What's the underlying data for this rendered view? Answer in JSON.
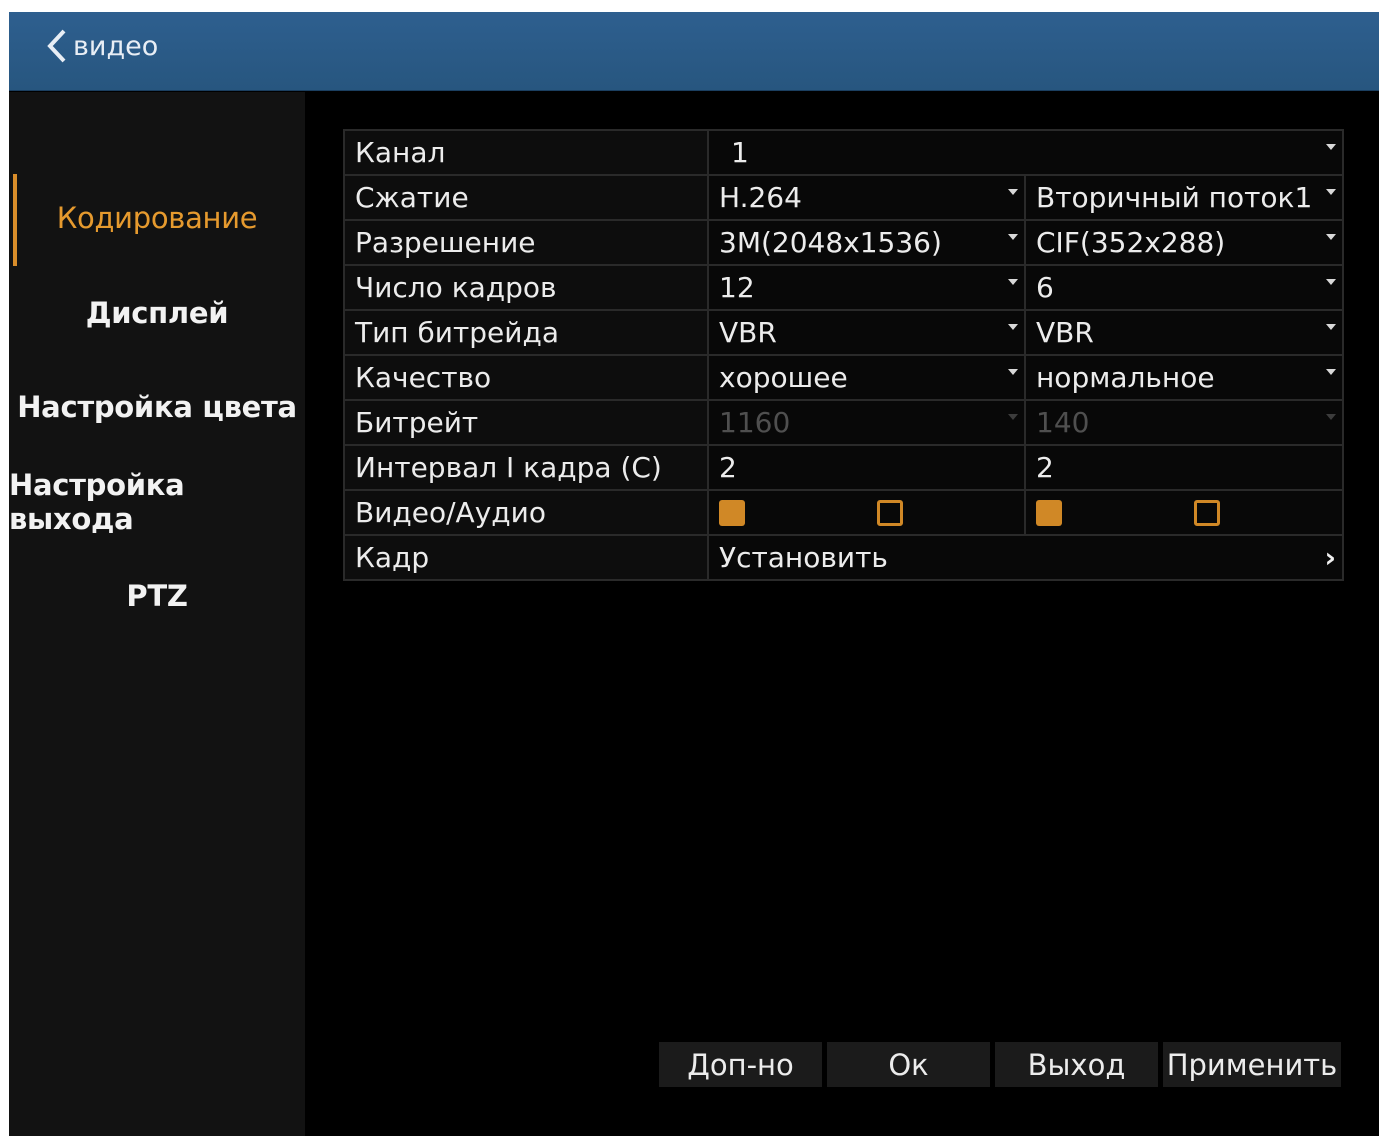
{
  "window": {
    "title": "видео",
    "back_icon": "chevron-left-icon"
  },
  "sidebar": {
    "items": [
      {
        "label": "Кодирование",
        "active": true
      },
      {
        "label": "Дисплей",
        "active": false
      },
      {
        "label": "Настройка цвета",
        "active": false
      },
      {
        "label": "Настройка выхода",
        "active": false
      },
      {
        "label": "PTZ",
        "active": false
      }
    ]
  },
  "settings": {
    "channel": {
      "label": "Канал",
      "value": "1"
    },
    "compression": {
      "label": "Сжатие",
      "main": "H.264",
      "sub": "Вторичный поток1"
    },
    "resolution": {
      "label": "Разрешение",
      "main": "3M(2048x1536)",
      "sub": "CIF(352x288)"
    },
    "framerate": {
      "label": "Число кадров",
      "main": "12",
      "sub": "6"
    },
    "bitrate_type": {
      "label": "Тип битрейда",
      "main": "VBR",
      "sub": "VBR"
    },
    "quality": {
      "label": "Качество",
      "main": "хорошее",
      "sub": "нормальное"
    },
    "bitrate": {
      "label": "Битрейт",
      "main": "1160",
      "sub": "140"
    },
    "iframe_interval": {
      "label": "Интервал I кадра (C)",
      "main": "2",
      "sub": "2"
    },
    "video_audio": {
      "label": "Видео/Аудио",
      "main_video": true,
      "main_audio": false,
      "sub_video": true,
      "sub_audio": false
    },
    "frame": {
      "label": "Кадр",
      "value": "Установить"
    }
  },
  "buttons": {
    "extra": "Доп-но",
    "ok": "Ок",
    "exit": "Выход",
    "apply": "Применить"
  },
  "colors": {
    "accent": "#d08826",
    "titlebar": "#2b5b89",
    "background": "#000000"
  }
}
